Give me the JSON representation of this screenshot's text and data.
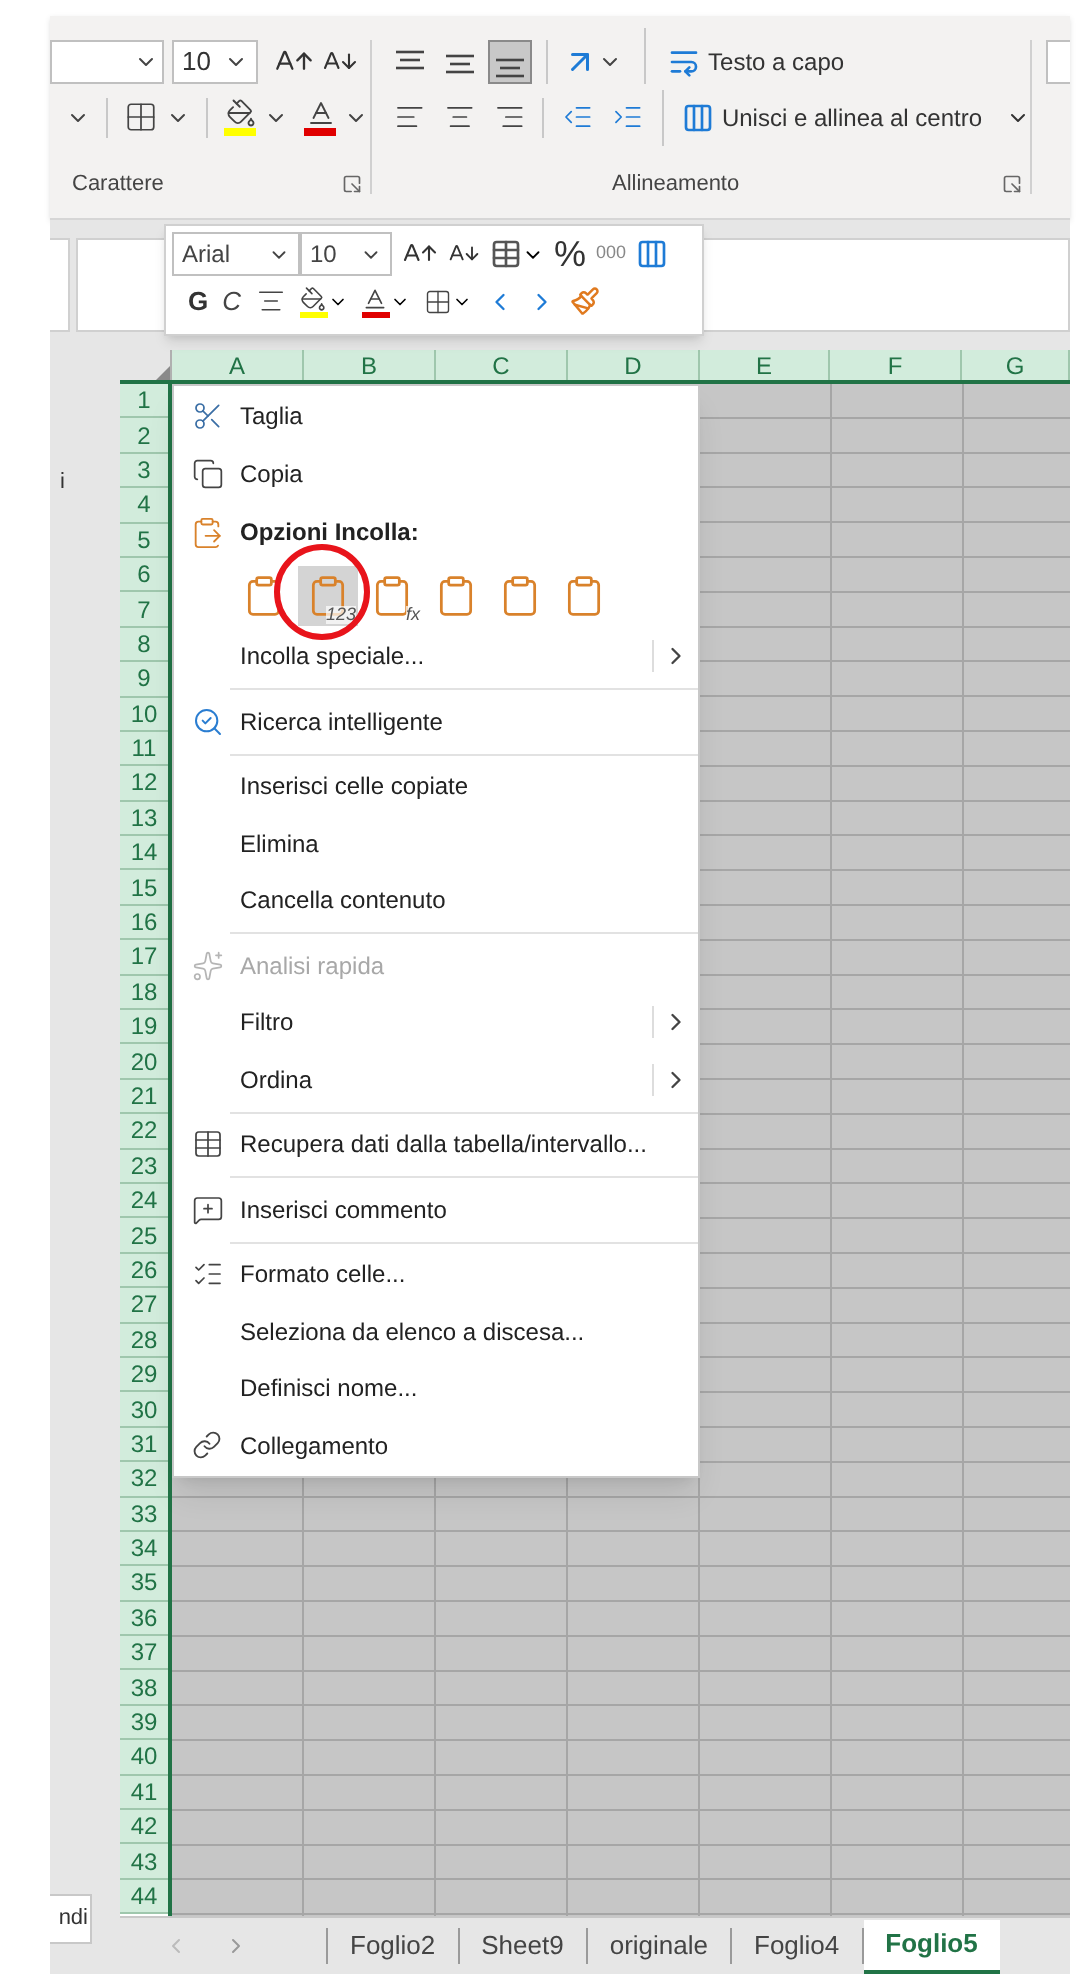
{
  "ribbon": {
    "font_size": "10",
    "vertical_align": [
      {
        "selected": false
      },
      {
        "selected": false
      },
      {
        "selected": true
      }
    ],
    "wrap_text": "Testo a capo",
    "merge": "Unisci e allinea al centro",
    "groups": [
      "Carattere",
      "Allineamento"
    ]
  },
  "mini_toolbar": {
    "font": "Arial",
    "size": "10",
    "percent": "%",
    "thousands": "000",
    "bold": "G",
    "italic": "C"
  },
  "context_menu": [
    {
      "kind": "item",
      "label": "Taglia",
      "disabled": false,
      "submenu": false
    },
    {
      "kind": "item",
      "label": "Copia",
      "disabled": false,
      "submenu": false
    },
    {
      "kind": "header",
      "label": "Opzioni Incolla:"
    },
    {
      "kind": "paste_options",
      "options": [
        {
          "selected": false
        },
        {
          "selected": true,
          "badge": "123"
        },
        {
          "selected": false,
          "badge": "fx"
        },
        {
          "selected": false
        },
        {
          "selected": false
        },
        {
          "selected": false
        }
      ]
    },
    {
      "kind": "item",
      "label": "Incolla speciale...",
      "disabled": false,
      "submenu": true
    },
    {
      "kind": "separator"
    },
    {
      "kind": "item",
      "label": "Ricerca intelligente",
      "disabled": false,
      "submenu": false
    },
    {
      "kind": "separator"
    },
    {
      "kind": "item",
      "label": "Inserisci celle copiate",
      "disabled": false,
      "submenu": false
    },
    {
      "kind": "item",
      "label": "Elimina",
      "disabled": false,
      "submenu": false
    },
    {
      "kind": "item",
      "label": "Cancella contenuto",
      "disabled": false,
      "submenu": false
    },
    {
      "kind": "separator"
    },
    {
      "kind": "item",
      "label": "Analisi rapida",
      "disabled": true,
      "submenu": false
    },
    {
      "kind": "item",
      "label": "Filtro",
      "disabled": false,
      "submenu": true
    },
    {
      "kind": "item",
      "label": "Ordina",
      "disabled": false,
      "submenu": true
    },
    {
      "kind": "separator"
    },
    {
      "kind": "item",
      "label": "Recupera dati dalla tabella/intervallo...",
      "disabled": false,
      "submenu": false
    },
    {
      "kind": "separator"
    },
    {
      "kind": "item",
      "label": "Inserisci commento",
      "disabled": false,
      "submenu": false
    },
    {
      "kind": "separator"
    },
    {
      "kind": "item",
      "label": "Formato celle...",
      "disabled": false,
      "submenu": false
    },
    {
      "kind": "item",
      "label": "Seleziona da elenco a discesa...",
      "disabled": false,
      "submenu": false
    },
    {
      "kind": "item",
      "label": "Definisci nome...",
      "disabled": false,
      "submenu": false
    },
    {
      "kind": "item",
      "label": "Collegamento",
      "disabled": false,
      "submenu": false
    }
  ],
  "sheet": {
    "columns": [
      "A",
      "B",
      "C",
      "D",
      "E",
      "F",
      "G"
    ],
    "rows": [
      "1",
      "2",
      "3",
      "4",
      "5",
      "6",
      "7",
      "8",
      "9",
      "10",
      "11",
      "12",
      "13",
      "14",
      "15",
      "16",
      "17",
      "18",
      "19",
      "20",
      "21",
      "22",
      "23",
      "24",
      "25",
      "26",
      "27",
      "28",
      "29",
      "30",
      "31",
      "32",
      "33",
      "34",
      "35",
      "36",
      "37",
      "38",
      "39",
      "40",
      "41",
      "42",
      "43",
      "44"
    ]
  },
  "side_panel": {
    "text": "i",
    "button": "ndi"
  },
  "sheet_tabs": [
    {
      "label": "Foglio2",
      "selected": false
    },
    {
      "label": "Sheet9",
      "selected": false
    },
    {
      "label": "originale",
      "selected": false
    },
    {
      "label": "Foglio4",
      "selected": false
    },
    {
      "label": "Foglio5",
      "selected": true
    }
  ]
}
